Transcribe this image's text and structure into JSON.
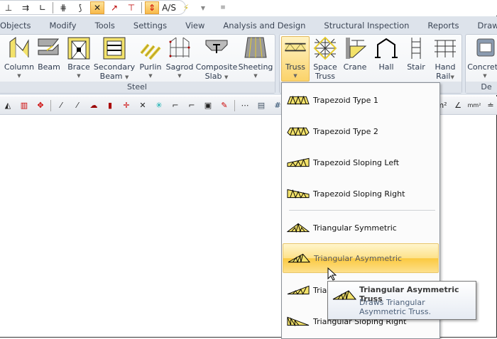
{
  "quick_access": {
    "icons": [
      "axis-icon",
      "arrows-icon",
      "corner-icon",
      "grid-lock-icon",
      "node-lock-icon",
      "snap-lock-icon",
      "point-line-icon",
      "point-axis-icon",
      "dimension-icon",
      "as-icon",
      "lightning-icon",
      "dropdown-icon",
      "customize-icon"
    ],
    "as_label": "A/S"
  },
  "tabs": [
    "Objects",
    "Modify",
    "Tools",
    "Settings",
    "View",
    "Analysis and Design",
    "Structural Inspection",
    "Reports",
    "Drawing"
  ],
  "ribbon": {
    "steel": {
      "label": "Steel",
      "buttons": [
        {
          "label": "Column",
          "label2": "",
          "arrow": true
        },
        {
          "label": "Beam",
          "label2": "",
          "arrow": false
        },
        {
          "label": "Brace",
          "label2": "",
          "arrow": true
        },
        {
          "label": "Secondary",
          "label2": "Beam",
          "arrow": true
        },
        {
          "label": "Purlin",
          "label2": "",
          "arrow": true
        },
        {
          "label": "Sagrod",
          "label2": "",
          "arrow": true
        },
        {
          "label": "Composite",
          "label2": "Slab",
          "arrow": true
        },
        {
          "label": "Sheeting",
          "label2": "",
          "arrow": true
        }
      ]
    },
    "truss_group": {
      "buttons": [
        {
          "label": "Truss",
          "label2": "",
          "arrow": true,
          "selected": true
        },
        {
          "label": "Space",
          "label2": "Truss"
        },
        {
          "label": "Crane",
          "label2": ""
        },
        {
          "label": "Hall",
          "label2": ""
        },
        {
          "label": "Stair",
          "label2": ""
        },
        {
          "label": "Hand",
          "label2": "Rail"
        }
      ]
    },
    "concrete": {
      "button": "Concrete",
      "label": "De"
    }
  },
  "truss_menu": {
    "items": [
      {
        "label": "Trapezoid Type 1",
        "icon": "trapezoid-type1-icon"
      },
      {
        "label": "Trapezoid Type 2",
        "icon": "trapezoid-type2-icon"
      },
      {
        "label": "Trapezoid Sloping Left",
        "icon": "trapezoid-sloping-left-icon"
      },
      {
        "label": "Trapezoid Sloping Right",
        "icon": "trapezoid-sloping-right-icon"
      },
      {
        "label": "Triangular Symmetric",
        "icon": "triangular-symmetric-icon"
      },
      {
        "label": "Triangular Asymmetric",
        "icon": "triangular-asymmetric-icon",
        "highlighted": true
      },
      {
        "label": "Triangular Sloping Left",
        "icon": "triangular-sloping-left-icon"
      },
      {
        "label": "Triangular Sloping Right",
        "icon": "triangular-sloping-right-icon"
      }
    ]
  },
  "tooltip": {
    "title": "Triangular Asymmetric Truss",
    "description": "Draws Triangular Asymmetric Truss."
  },
  "colors": {
    "accent": "#fbc940",
    "icon_yellow": "#f5e05a",
    "tab_bg": "#dde3eb"
  }
}
